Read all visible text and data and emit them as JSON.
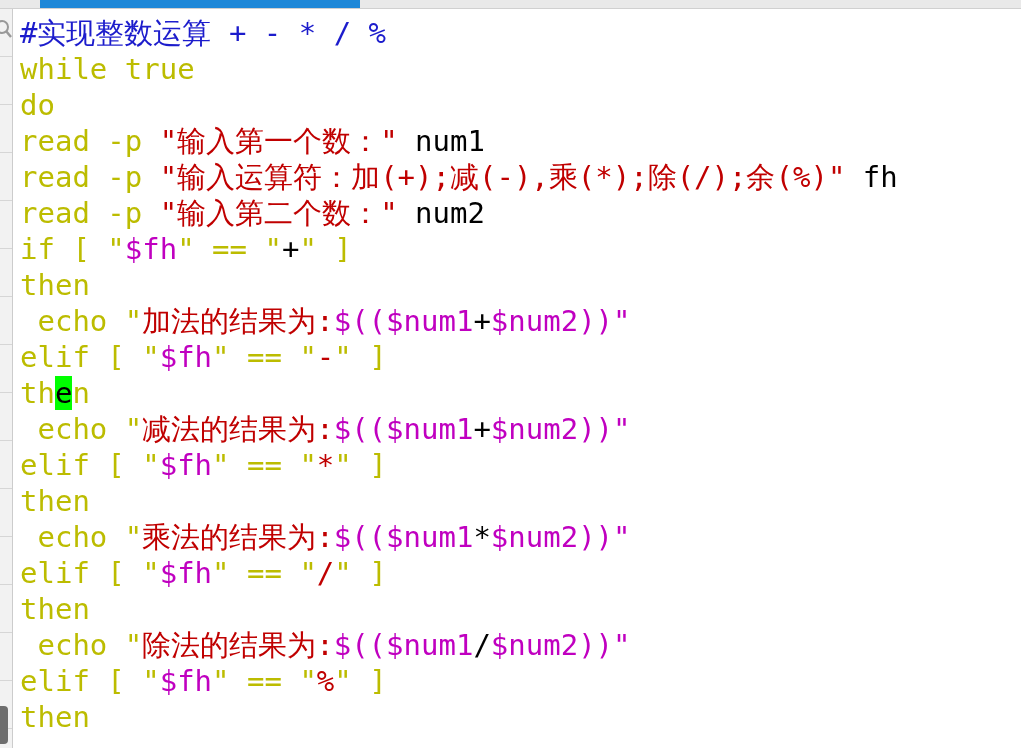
{
  "editor": {
    "lines": [
      {
        "tokens": [
          {
            "text": "#实现整数运算 + - * / %",
            "kind": "comment"
          }
        ]
      },
      {
        "tokens": [
          {
            "text": "while true",
            "kind": "keyword"
          }
        ]
      },
      {
        "tokens": [
          {
            "text": "do",
            "kind": "keyword"
          }
        ]
      },
      {
        "tokens": [
          {
            "text": "read -p ",
            "kind": "keyword"
          },
          {
            "text": "\"输入第一个数：\"",
            "kind": "string"
          },
          {
            "text": " num1",
            "kind": "plain"
          }
        ]
      },
      {
        "tokens": [
          {
            "text": "read -p ",
            "kind": "keyword"
          },
          {
            "text": "\"输入运算符：加(+);减(-),乘(*);除(/);余(%)\"",
            "kind": "string"
          },
          {
            "text": " fh",
            "kind": "plain"
          }
        ]
      },
      {
        "tokens": [
          {
            "text": "read -p ",
            "kind": "keyword"
          },
          {
            "text": "\"输入第二个数：\"",
            "kind": "string"
          },
          {
            "text": " num2",
            "kind": "plain"
          }
        ]
      },
      {
        "tokens": [
          {
            "text": "if [ \"",
            "kind": "keyword"
          },
          {
            "text": "$fh",
            "kind": "variable"
          },
          {
            "text": "\" == \"",
            "kind": "keyword"
          },
          {
            "text": "+",
            "kind": "plain"
          },
          {
            "text": "\" ]",
            "kind": "keyword"
          }
        ]
      },
      {
        "tokens": [
          {
            "text": "then",
            "kind": "keyword"
          }
        ]
      },
      {
        "tokens": [
          {
            "text": " echo \"",
            "kind": "keyword"
          },
          {
            "text": "加法的结果为:",
            "kind": "string"
          },
          {
            "text": "$(($num1",
            "kind": "variable"
          },
          {
            "text": "+",
            "kind": "plain"
          },
          {
            "text": "$num2))\"",
            "kind": "variable"
          }
        ]
      },
      {
        "tokens": [
          {
            "text": "elif [ \"",
            "kind": "keyword"
          },
          {
            "text": "$fh",
            "kind": "variable"
          },
          {
            "text": "\" == \"",
            "kind": "keyword"
          },
          {
            "text": "-",
            "kind": "string"
          },
          {
            "text": "\" ]",
            "kind": "keyword"
          }
        ]
      },
      {
        "tokens": [
          {
            "text": "th",
            "kind": "keyword"
          },
          {
            "text": "e",
            "kind": "keyword",
            "cursor": true
          },
          {
            "text": "n",
            "kind": "keyword"
          }
        ]
      },
      {
        "tokens": [
          {
            "text": " echo \"",
            "kind": "keyword"
          },
          {
            "text": "减法的结果为:",
            "kind": "string"
          },
          {
            "text": "$(($num1",
            "kind": "variable"
          },
          {
            "text": "+",
            "kind": "plain"
          },
          {
            "text": "$num2))\"",
            "kind": "variable"
          }
        ]
      },
      {
        "tokens": [
          {
            "text": "elif [ \"",
            "kind": "keyword"
          },
          {
            "text": "$fh",
            "kind": "variable"
          },
          {
            "text": "\" == \"",
            "kind": "keyword"
          },
          {
            "text": "*",
            "kind": "string"
          },
          {
            "text": "\" ]",
            "kind": "keyword"
          }
        ]
      },
      {
        "tokens": [
          {
            "text": "then",
            "kind": "keyword"
          }
        ]
      },
      {
        "tokens": [
          {
            "text": " echo \"",
            "kind": "keyword"
          },
          {
            "text": "乘法的结果为:",
            "kind": "string"
          },
          {
            "text": "$(($num1",
            "kind": "variable"
          },
          {
            "text": "*",
            "kind": "plain"
          },
          {
            "text": "$num2))\"",
            "kind": "variable"
          }
        ]
      },
      {
        "tokens": [
          {
            "text": "elif [ \"",
            "kind": "keyword"
          },
          {
            "text": "$fh",
            "kind": "variable"
          },
          {
            "text": "\" == \"",
            "kind": "keyword"
          },
          {
            "text": "/",
            "kind": "string"
          },
          {
            "text": "\" ]",
            "kind": "keyword"
          }
        ]
      },
      {
        "tokens": [
          {
            "text": "then",
            "kind": "keyword"
          }
        ]
      },
      {
        "tokens": [
          {
            "text": " echo \"",
            "kind": "keyword"
          },
          {
            "text": "除法的结果为:",
            "kind": "string"
          },
          {
            "text": "$(($num1",
            "kind": "variable"
          },
          {
            "text": "/",
            "kind": "plain"
          },
          {
            "text": "$num2))\"",
            "kind": "variable"
          }
        ]
      },
      {
        "tokens": [
          {
            "text": "elif [ \"",
            "kind": "keyword"
          },
          {
            "text": "$fh",
            "kind": "variable"
          },
          {
            "text": "\" == \"",
            "kind": "keyword"
          },
          {
            "text": "%",
            "kind": "string"
          },
          {
            "text": "\" ]",
            "kind": "keyword"
          }
        ]
      },
      {
        "tokens": [
          {
            "text": "then",
            "kind": "keyword"
          }
        ]
      }
    ]
  }
}
